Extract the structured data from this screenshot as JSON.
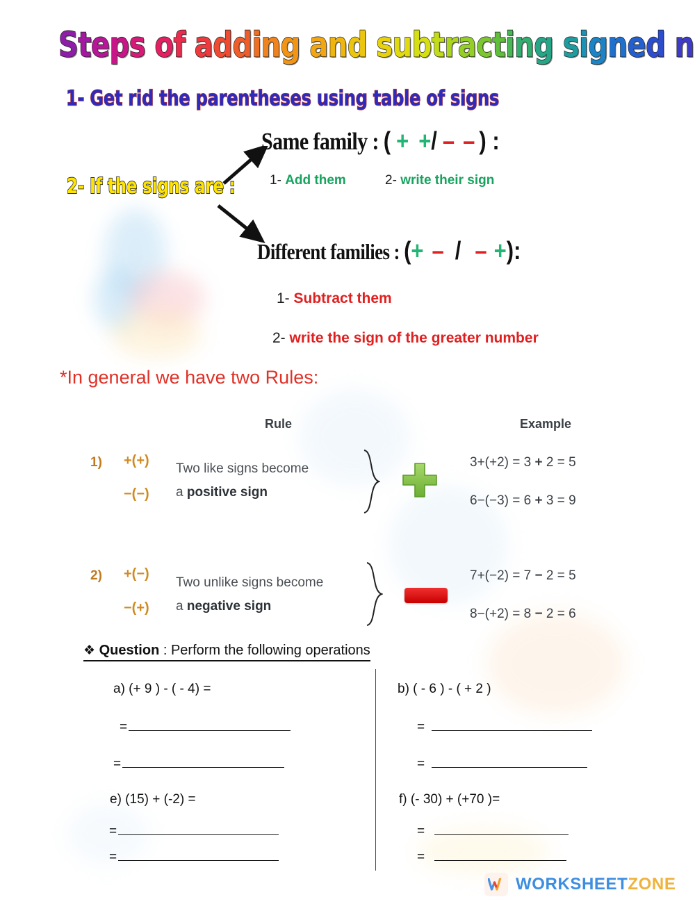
{
  "title": {
    "text": "Steps of adding and subtracting signed numbers",
    "style": "rainbow-wordart",
    "colors": [
      "#8e1ea8",
      "#b3169b",
      "#d21580",
      "#e7245c",
      "#ef3b3b",
      "#ef5a2b",
      "#f07d1e",
      "#f39c14",
      "#f0b90f",
      "#e8d20c",
      "#dbe010",
      "#b9da1c",
      "#8ecd27",
      "#5fbf3a",
      "#34b06a",
      "#1da196",
      "#1b8fc0",
      "#1f6fd0",
      "#2a4fcf",
      "#4a2fc4",
      "#6b21b6",
      "#8e1ea8",
      "#b3169b"
    ]
  },
  "step1": {
    "text": "1- Get rid the parentheses using table of signs",
    "fill": "#2b2bbf",
    "outline": "#c0392b"
  },
  "step2": {
    "text": "2- If  the signs  are :",
    "fill": "#ffe400",
    "outline": "#1a1a1a"
  },
  "same_family": {
    "label": "Same family",
    "colon": " : ",
    "open_paren": "(",
    "sign1": "+",
    "sign2": "+",
    "slash": "/",
    "sign3": "–",
    "sign4": "–",
    "close_paren": ") :",
    "sub1_num": "1- ",
    "sub1_text": "Add them",
    "sub2_num": "2- ",
    "sub2_text": "write their sign",
    "accent_color": "#17a35e"
  },
  "different_families": {
    "label": "Different families",
    "colon": " : ",
    "open_paren": "(",
    "sign1": "+",
    "sign2": "–",
    "slash": "/",
    "sign3": "–",
    "sign4": "+",
    "close_paren": "):",
    "sub1_num": "1- ",
    "sub1_text": "Subtract them",
    "sub2_num": "2- ",
    "sub2_text": "write  the  sign of the greater number",
    "accent_color": "#e02020"
  },
  "general_note": "*In general we have two Rules:",
  "rules_table": {
    "headers": {
      "rule": "Rule",
      "example": "Example"
    },
    "rows": [
      {
        "number": "1)",
        "sign_top": "+(+)",
        "sign_bottom": "−(−)",
        "text_line1": "Two like signs become",
        "text_line2_plain": "a ",
        "text_line2_bold": "positive sign",
        "icon": "plus-icon",
        "icon_color": "#7ac143",
        "examples": [
          {
            "left": "3+(+2) = 3 ",
            "op": "+",
            "right": " 2 = 5"
          },
          {
            "left": "6−(−3) = 6 ",
            "op": "+",
            "right": " 3 = 9"
          }
        ]
      },
      {
        "number": "2)",
        "sign_top": "+(−)",
        "sign_bottom": "−(+)",
        "text_line1": "Two unlike signs become",
        "text_line2_plain": "a ",
        "text_line2_bold": "negative sign",
        "icon": "minus-icon",
        "icon_color": "#e01010",
        "examples": [
          {
            "left": "7+(−2) = 7 ",
            "op": "−",
            "right": " 2 = 5"
          },
          {
            "left": "8−(+2) = 8 ",
            "op": "−",
            "right": " 2 = 6"
          }
        ]
      }
    ]
  },
  "question": {
    "bullet": "❖",
    "label": "Question",
    "prompt": " : Perform the following operations",
    "problems": [
      {
        "id": "a",
        "text": "a) (+ 9 ) - ( - 4) ="
      },
      {
        "id": "b",
        "text": "b) ( - 6 ) - ( + 2 )"
      },
      {
        "id": "e",
        "text": "e) (15) + (-2) ="
      },
      {
        "id": "f",
        "text": "f) (- 30) + (+70 )="
      }
    ],
    "answer_prefix": "="
  },
  "footer": {
    "logo_part1": "WORKSHEET",
    "logo_part2": "ZONE",
    "logo_color1": "#3d8ee0",
    "logo_color2": "#efb23c"
  }
}
